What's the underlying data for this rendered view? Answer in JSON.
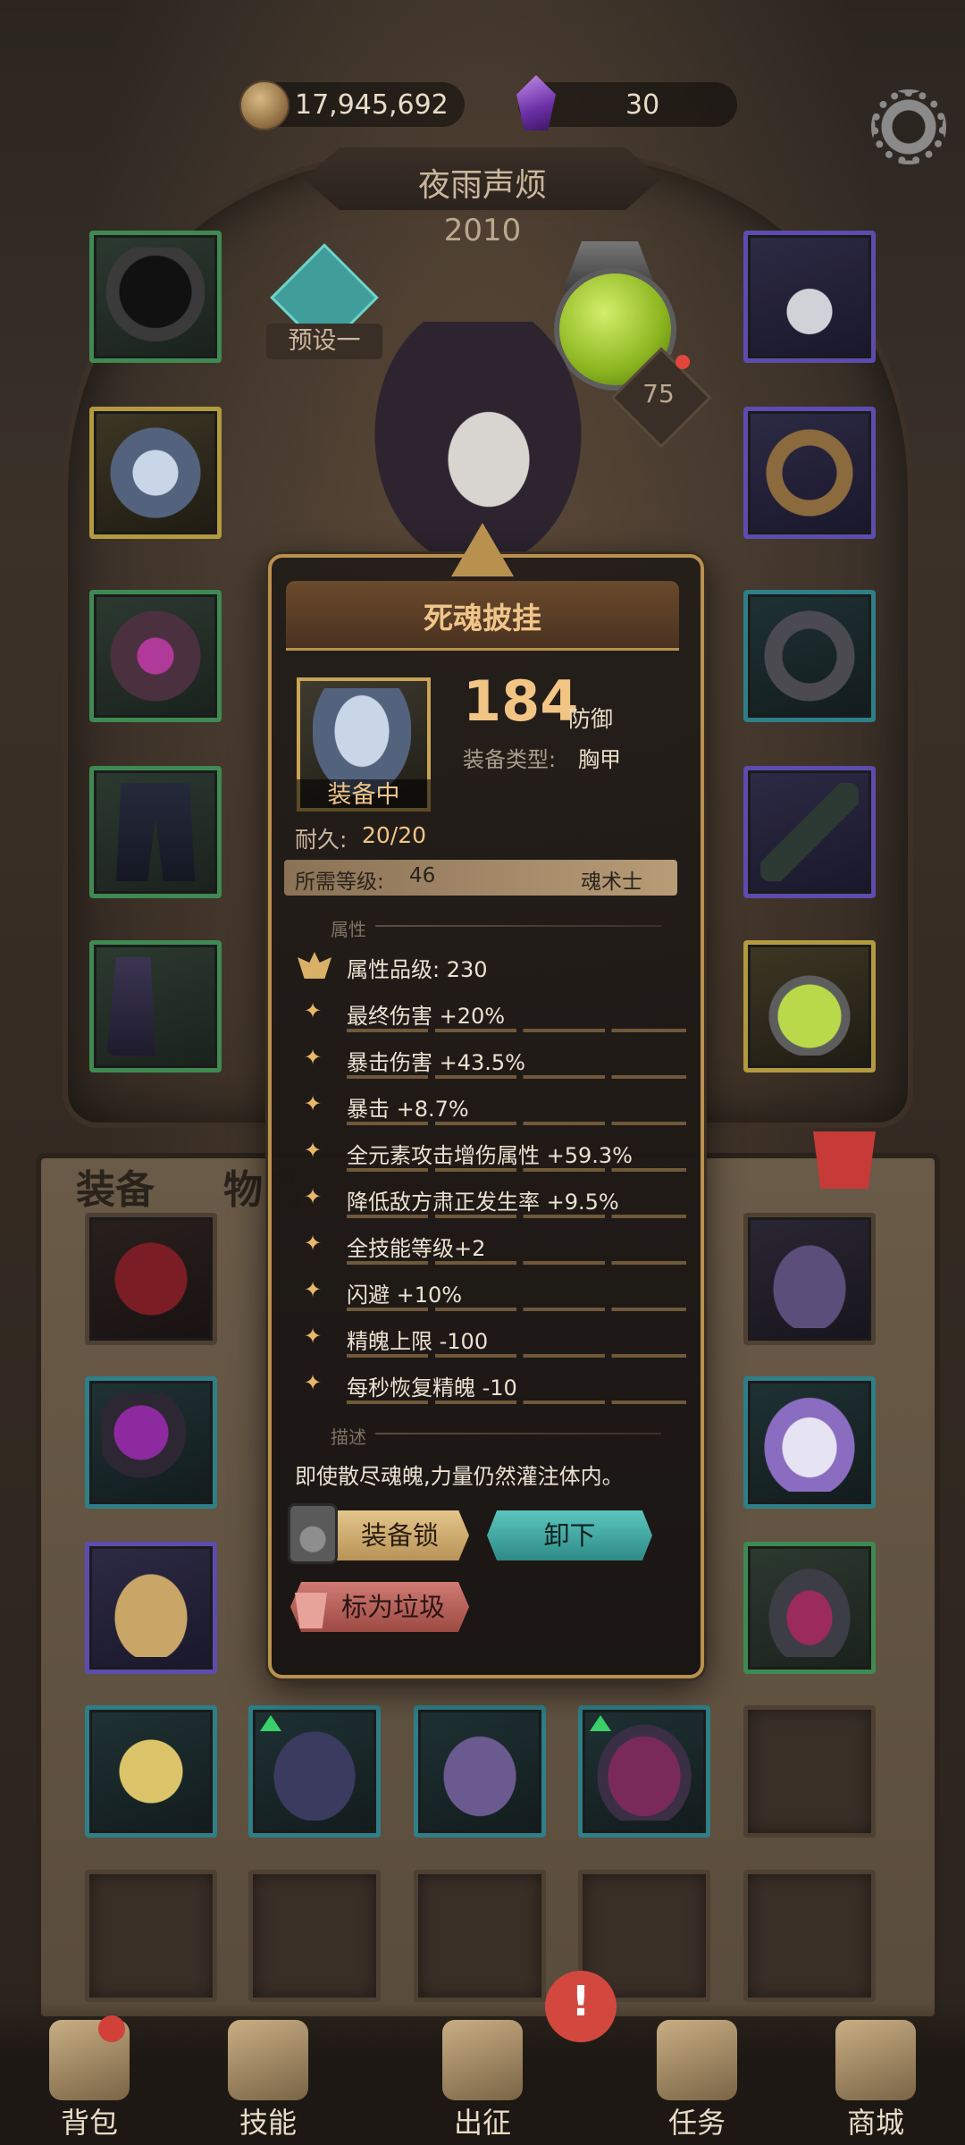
{
  "currency": {
    "gold": "17,945,692",
    "gems": "30"
  },
  "header": {
    "character_name": "夜雨声烦",
    "character_level": "2010",
    "preset_label": "预设一",
    "pet_level": "75"
  },
  "inventory": {
    "tab_equipment": "装备",
    "tab_items": "物品"
  },
  "tooltip": {
    "item_name": "死魂披挂",
    "equipped_label": "装备中",
    "defense_value": "184",
    "defense_unit": "防御",
    "type_label": "装备类型:",
    "type_value": "胸甲",
    "durability_label": "耐久:",
    "durability_value": "20/20",
    "required_level_label": "所需等级:",
    "required_level_value": "46",
    "class_name": "魂术士",
    "attributes_heading": "属性",
    "attribute_grade": "属性品级: 230",
    "stats": [
      "最终伤害 +20%",
      "暴击伤害 +43.5%",
      "暴击 +8.7%",
      "全元素攻击增伤属性 +59.3%",
      "降低敌方肃正发生率 +9.5%",
      "全技能等级+2",
      "闪避 +10%",
      "精魄上限 -100",
      "每秒恢复精魄 -10"
    ],
    "description_heading": "描述",
    "description": "即使散尽魂魄,力量仍然灌注体内。",
    "btn_lock": "装备锁",
    "btn_unequip": "卸下",
    "btn_junk": "标为垃圾"
  },
  "bottom_nav": {
    "bag": "背包",
    "skills": "技能",
    "expedition": "出征",
    "quests": "任务",
    "shop": "商城",
    "alert_mark": "!"
  },
  "colors": {
    "accent_gold": "#f3c585",
    "rarity_green": "#3e8a52",
    "rarity_blue": "#5d4cb0",
    "rarity_gold": "#b39a3e",
    "rarity_teal": "#2e7f87",
    "unequip_teal": "#5bc5bf"
  },
  "icons": [
    "gold-coin-icon",
    "gem-icon",
    "gear-icon",
    "preset-icon",
    "trash-icon",
    "lock-icon",
    "junk-icon",
    "bag-icon",
    "skills-icon",
    "expedition-icon",
    "quests-icon",
    "shop-icon"
  ]
}
